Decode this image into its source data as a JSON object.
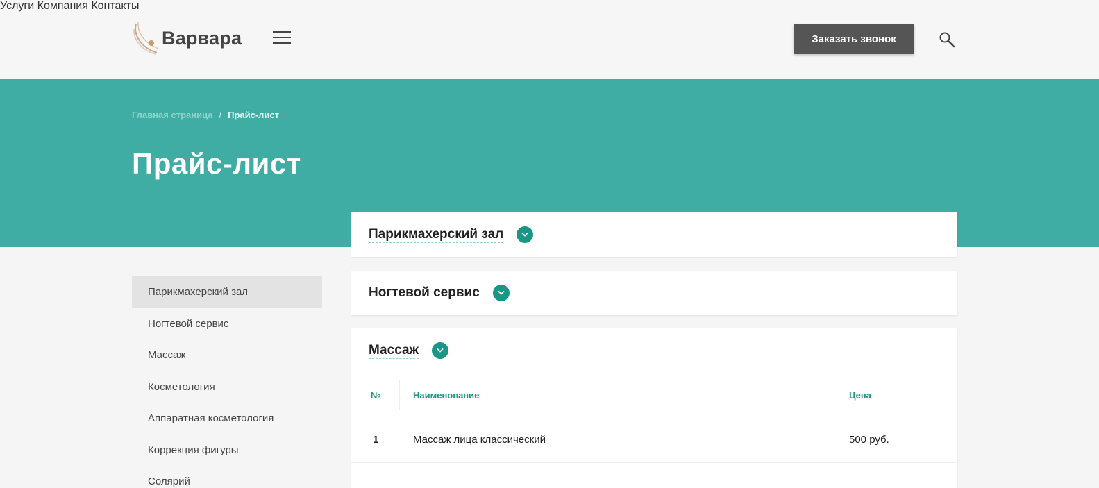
{
  "header": {
    "logo_text": "Варвара",
    "nav": [
      "Услуги",
      "Компания",
      "Контакты"
    ],
    "callback_label": "Заказать звонок"
  },
  "breadcrumb": {
    "home": "Главная страница",
    "separator": "/",
    "current": "Прайс-лист"
  },
  "page_title": "Прайс-лист",
  "sidebar": {
    "items": [
      "Парикмахерский зал",
      "Ногтевой сервис",
      "Массаж",
      "Косметология",
      "Аппаратная косметология",
      "Коррекция фигуры",
      "Солярий"
    ]
  },
  "panels": [
    {
      "title": "Парикмахерский зал"
    },
    {
      "title": "Ногтевой сервис"
    },
    {
      "title": "Массаж"
    }
  ],
  "table": {
    "headers": {
      "num": "№",
      "name": "Наименование",
      "price": "Цена"
    },
    "rows": [
      {
        "num": "1",
        "name": "Массаж лица классический",
        "price": "500 руб."
      }
    ]
  },
  "colors": {
    "accent": "#3fada4",
    "accent_dark": "#1a9687",
    "button": "#555555"
  }
}
